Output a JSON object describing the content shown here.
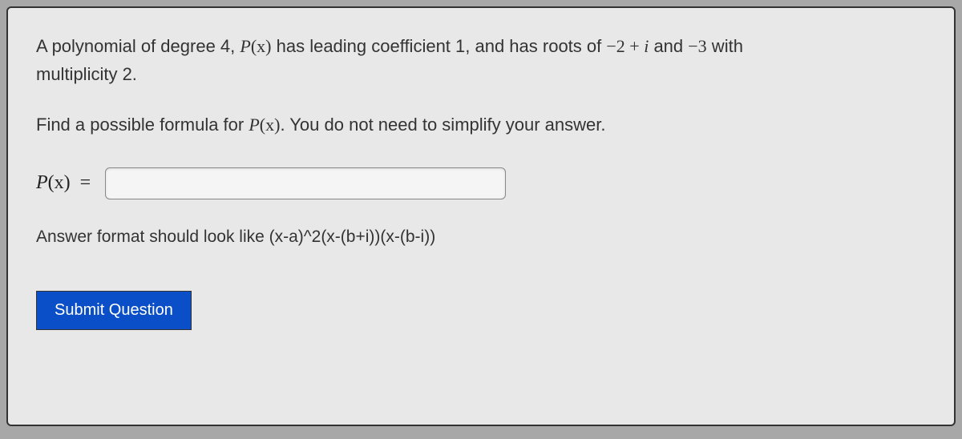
{
  "problem": {
    "line1_part1": "A polynomial of degree 4, ",
    "px": "P",
    "paren_x": "(x)",
    "line1_part2": " has leading coefficient 1, and has roots of ",
    "root1": "−2 + i",
    "line1_part3": " and ",
    "root2": "−3",
    "line1_part4": " with",
    "line2": "multiplicity 2."
  },
  "instruction": {
    "part1": "Find a possible formula for ",
    "px": "P",
    "paren_x": "(x)",
    "part2": ". You do not need to simplify your answer."
  },
  "answer": {
    "label_p": "P",
    "label_x": "(x)",
    "equals": "=",
    "value": ""
  },
  "format_hint": "Answer format should look like (x-a)^2(x-(b+i))(x-(b-i))",
  "submit_label": "Submit Question"
}
